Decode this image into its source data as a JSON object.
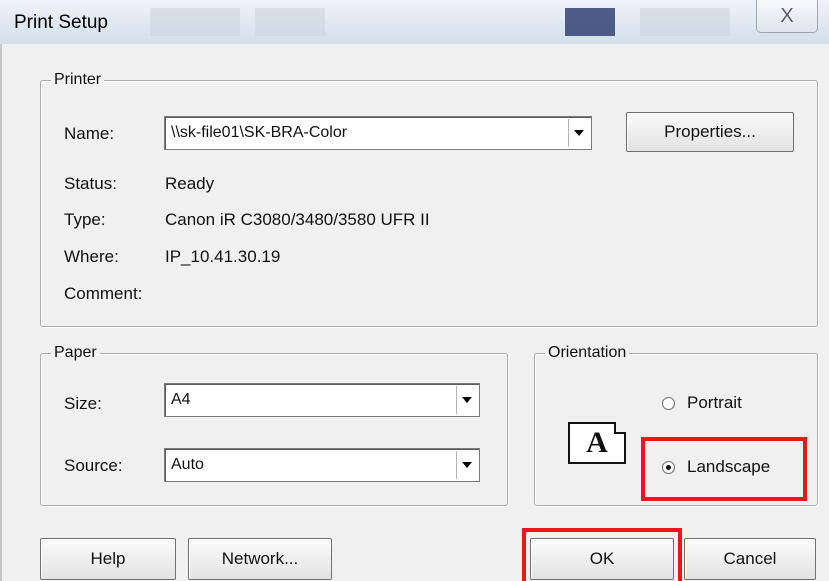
{
  "window": {
    "title": "Print Setup",
    "close_glyph": "X"
  },
  "printer": {
    "legend": "Printer",
    "name_label": "Name:",
    "name_value": "\\\\sk-file01\\SK-BRA-Color",
    "properties_button": "Properties...",
    "status_label": "Status:",
    "status_value": "Ready",
    "type_label": "Type:",
    "type_value": "Canon iR C3080/3480/3580 UFR II",
    "where_label": "Where:",
    "where_value": "IP_10.41.30.19",
    "comment_label": "Comment:",
    "comment_value": ""
  },
  "paper": {
    "legend": "Paper",
    "size_label": "Size:",
    "size_value": "A4",
    "source_label": "Source:",
    "source_value": "Auto"
  },
  "orientation": {
    "legend": "Orientation",
    "icon_letter": "A",
    "portrait_label": "Portrait",
    "landscape_label": "Landscape",
    "selected": "Landscape"
  },
  "buttons": {
    "help": "Help",
    "network": "Network...",
    "ok": "OK",
    "cancel": "Cancel"
  },
  "highlight_color": "#e8171b",
  "icons": [
    "close-icon",
    "dropdown-arrow-icon",
    "landscape-orientation-icon",
    "radio-icon"
  ]
}
